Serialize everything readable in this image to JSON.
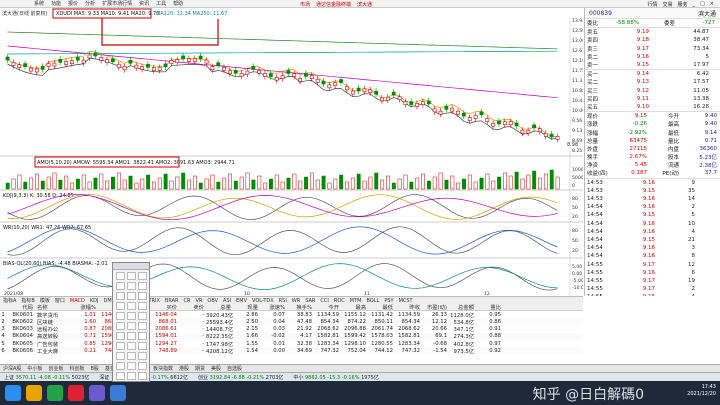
{
  "menubar": {
    "items": [
      "系统",
      "功能",
      "报价",
      "分析",
      "扩展市场行情",
      "资讯",
      "工具",
      "帮助"
    ]
  },
  "window_title": {
    "left": "市场",
    "center": "通达信金融终端",
    "right": "滨大通"
  },
  "window_controls": [
    "行情",
    "交易",
    "服务",
    "_",
    "□",
    "×"
  ],
  "main_chart": {
    "legend_prefix": "滨大通(日线 前复权)",
    "ma_legend": "XDUDI MA5: 9.33 MA10: 9.41 MA20: 9.70",
    "ma_legend_tail": "MA120: 12.34 MA250: 11.67",
    "price_ticks": [
      "13.93",
      "13.50",
      "13.06",
      "12.63",
      "12.19",
      "11.75",
      "11.31",
      "10.88",
      "10.44",
      "10.00",
      "9.56",
      "9.13",
      "8.69",
      "8.25"
    ],
    "low_label": "8.98",
    "amo_legend": "AMO(5,10,20) AMOW: 5595.34 AMO1: 3822.41 AMO2: 3091.63 AMO3: 2944.71",
    "amo_ticks": [
      "10000",
      "5000",
      "0"
    ],
    "kdj_legend": "KDJ(9,3,3) K: 30.58 D: 24.85",
    "kdj_ticks": [
      "80",
      "50",
      "20"
    ],
    "wr_legend": "WR(10,20) WR1: 47.26 WR2: 67.65",
    "wr_ticks": [
      "80",
      "50",
      "20"
    ],
    "bias_legend": "BIAS-QL(20,60) BIAS: -4.48 BIASMA: -2.01",
    "bias_ticks": [
      "5.00",
      "0.00",
      "-5.00",
      "-10.00"
    ],
    "date_labels": [
      "2021/08",
      "09",
      "10",
      "11",
      "12"
    ]
  },
  "quote": {
    "code": "000839",
    "name": "滨大通",
    "weibi_label": "委比",
    "weibi_val": "-58.88%",
    "weicha_label": "委差",
    "weicha_val": "-727",
    "sells": [
      {
        "label": "卖五",
        "price": "9.19",
        "vol": "44.87"
      },
      {
        "label": "卖四",
        "price": "9.18",
        "vol": "38.47"
      },
      {
        "label": "卖三",
        "price": "9.17",
        "vol": "73.34"
      },
      {
        "label": "卖二",
        "price": "9.16",
        "vol": "5"
      },
      {
        "label": "卖一",
        "price": "9.15",
        "vol": "17.97"
      }
    ],
    "buys": [
      {
        "label": "买一",
        "price": "9.14",
        "vol": "6.42"
      },
      {
        "label": "买二",
        "price": "9.13",
        "vol": "17.57"
      },
      {
        "label": "买三",
        "price": "9.12",
        "vol": "11.05"
      },
      {
        "label": "买四",
        "price": "9.11",
        "vol": "13.38"
      },
      {
        "label": "买五",
        "price": "9.10",
        "vol": "16.28"
      }
    ],
    "stats": [
      {
        "k1": "现价",
        "v1": "9.15",
        "k2": "今开",
        "v2": "9.40"
      },
      {
        "k1": "涨跌",
        "v1": "-0.26",
        "k2": "最高",
        "v2": "9.40"
      },
      {
        "k1": "涨幅",
        "v1": "-2.92%",
        "k2": "最低",
        "v2": "9.14"
      },
      {
        "k1": "总量",
        "v1": "63475",
        "k2": "量比",
        "v2": "0.71"
      },
      {
        "k1": "外盘",
        "v1": "27115",
        "k2": "内盘",
        "v2": "36360"
      },
      {
        "k1": "换手",
        "v1": "2.67%",
        "k2": "股本",
        "v2": "5.23亿"
      },
      {
        "k1": "净资",
        "v1": "5.45",
        "k2": "流通",
        "v2": "2.38亿"
      },
      {
        "k1": "收益(四)",
        "v1": "0.187",
        "k2": "PE(动)",
        "v2": "37.7"
      }
    ],
    "ticks": [
      {
        "t": "14:53",
        "p": "9.16",
        "v": "9"
      },
      {
        "t": "14:53",
        "p": "9.15",
        "v": "35"
      },
      {
        "t": "14:53",
        "p": "9.16",
        "v": "14"
      },
      {
        "t": "14:54",
        "p": "9.16",
        "v": "2"
      },
      {
        "t": "14:54",
        "p": "9.15",
        "v": "5"
      },
      {
        "t": "14:54",
        "p": "9.16",
        "v": "10"
      },
      {
        "t": "14:54",
        "p": "9.16",
        "v": "4"
      },
      {
        "t": "14:54",
        "p": "9.15",
        "v": "21"
      },
      {
        "t": "14:54",
        "p": "9.16",
        "v": "3"
      },
      {
        "t": "14:54",
        "p": "9.16",
        "v": "8"
      },
      {
        "t": "14:55",
        "p": "9.17",
        "v": "12"
      },
      {
        "t": "14:55",
        "p": "9.16",
        "v": "6"
      },
      {
        "t": "14:55",
        "p": "9.17",
        "v": "19"
      },
      {
        "t": "14:55",
        "p": "9.17",
        "v": "2"
      },
      {
        "t": "14:55",
        "p": "9.16",
        "v": "4"
      },
      {
        "t": "14:56",
        "p": "9.16",
        "v": "11"
      },
      {
        "t": "14:56",
        "p": "9.15",
        "v": "7"
      },
      {
        "t": "14:56",
        "p": "9.16",
        "v": "5"
      },
      {
        "t": "14:56",
        "p": "9.16",
        "v": "9"
      },
      {
        "t": "14:56",
        "p": "9.15",
        "v": "3"
      },
      {
        "t": "14:56",
        "p": "9.16",
        "v": "2"
      },
      {
        "t": "14:56",
        "p": "9.15",
        "v": "14"
      },
      {
        "t": "14:56",
        "p": "9.15",
        "v": "6"
      },
      {
        "t": "14:56",
        "p": "9.16",
        "v": "1"
      },
      {
        "t": "14:56",
        "p": "9.15",
        "v": "8"
      },
      {
        "t": "14:56",
        "p": "9.15",
        "v": "20"
      },
      {
        "t": "14:56",
        "p": "9.16",
        "v": "3"
      },
      {
        "t": "14:56",
        "p": "9.15",
        "v": "5"
      }
    ]
  },
  "tabs": [
    "指标A",
    "指标B",
    "模板",
    "窗口",
    "MACD",
    "KDJ",
    "DMI",
    "DMA",
    "FSL",
    "TRIX",
    "BRAR",
    "CR",
    "VR",
    "OBV",
    "ASI",
    "EMV",
    "VOL-TDX",
    "RSI",
    "WR",
    "SAR",
    "CCI",
    "ROC",
    "MTM",
    "BOLL",
    "PSY",
    "MCST"
  ],
  "table": {
    "headers": [
      "",
      "代码",
      "名称",
      "涨幅%",
      "现价",
      "涨跌",
      "买价",
      "卖价",
      "总量",
      "现量",
      "涨速%",
      "换手%",
      "今开",
      "最高",
      "最低",
      "昨收",
      "市盈(动)",
      "总金额",
      "量比"
    ],
    "rows": [
      [
        "1",
        "BK0601",
        "数字货币",
        "1.01",
        "1146.04",
        "11.45",
        "1146.04",
        "-",
        "3920.43亿",
        "2.86",
        "0.07",
        "38.83",
        "1134.59",
        "1155.12",
        "1131.42",
        "1134.59",
        "26.33",
        "1128.0亿",
        "0.95"
      ],
      [
        "2",
        "BK0602",
        "区块链",
        "1.60",
        "868.01",
        "13.67",
        "868.01",
        "-",
        "25593.4亿",
        "2.50",
        "0.04",
        "47.48",
        "854.34",
        "874.22",
        "850.11",
        "854.34",
        "12.12",
        "534.8亿",
        "0.86"
      ],
      [
        "3",
        "BK0603",
        "远程办公",
        "0.87",
        "2086.61",
        "17.99",
        "2086.61",
        "-",
        "14408.7亿",
        "2.15",
        "0.03",
        "21.92",
        "2068.62",
        "2096.88",
        "2061.74",
        "2068.62",
        "20.66",
        "347.1亿",
        "0.91"
      ],
      [
        "4",
        "BK0604",
        "高送转股",
        "0.71",
        "1594.01",
        "11.20",
        "1594.01",
        "-",
        "8222.35亿",
        "1.66",
        "-0.02",
        "4.17",
        "1582.81",
        "1599.42",
        "1578.03",
        "1582.81",
        "69.1",
        "274.3亿",
        "0.88"
      ],
      [
        "5",
        "BK0605",
        "广告包装",
        "0.85",
        "1294.27",
        "10.93",
        "1294.27",
        "-",
        "1747.98亿",
        "1.55",
        "0.01",
        "32.38",
        "1283.34",
        "1298.10",
        "1280.55",
        "1283.34",
        "-0.68",
        "402.8亿",
        "0.97"
      ],
      [
        "6",
        "BK0606",
        "工业大麻",
        "0.21",
        "748.89",
        "1.57",
        "748.89",
        "-",
        "4208.12亿",
        "1.54",
        "0.00",
        "34.69",
        "747.32",
        "752.04",
        "744.12",
        "747.32",
        "-1.54",
        "973.5亿",
        "0.92"
      ]
    ]
  },
  "bottombar": [
    "沪深A股",
    "中小板",
    "创业板",
    "科创板",
    "B股",
    "基金",
    "债券",
    "股转",
    "板块指数",
    "港股",
    "期货",
    "美股",
    "自选股"
  ],
  "statusbar": [
    {
      "label": "上证",
      "val": "3570.11",
      "chg": "-4.08",
      "pct": "-0.11%",
      "amt": "5023亿"
    },
    {
      "label": "深证",
      "val": "14318.2",
      "chg": "-24.88",
      "pct": "-0.17%",
      "amt": "6612亿"
    },
    {
      "label": "创业",
      "val": "3192.84",
      "chg": "-6.88",
      "pct": "-0.21%",
      "amt": "2703亿"
    },
    {
      "label": "中小",
      "val": "9862.05",
      "chg": "-15.3",
      "pct": "-0.16%",
      "amt": "1975亿"
    }
  ],
  "taskbar": {
    "watermark": "知乎 @日白解碼0",
    "time": "17:43",
    "date": "2021/12/20"
  },
  "colors": {
    "up": "#d40000",
    "down": "#008a00",
    "ma5": "#404040",
    "ma10": "#d0a000",
    "ma20": "#c000c0",
    "ma60": "#00a0a0"
  }
}
